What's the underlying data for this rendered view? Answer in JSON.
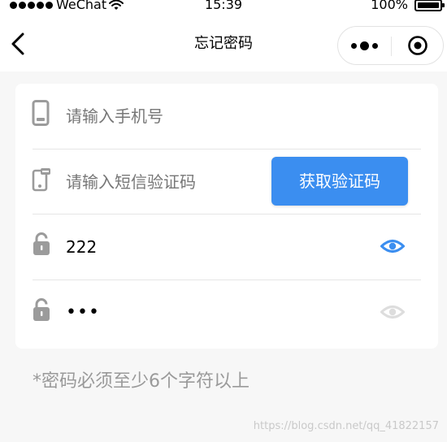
{
  "status_bar": {
    "carrier": "WeChat",
    "time": "15:39",
    "battery": "100%"
  },
  "nav": {
    "title": "忘记密码",
    "icons": [
      "back-chevron-icon",
      "more-dots-icon",
      "close-circle-icon"
    ]
  },
  "form": {
    "phone": {
      "placeholder": "请输入手机号",
      "value": "",
      "icon": "phone-icon"
    },
    "sms_code": {
      "placeholder": "请输入短信验证码",
      "value": "",
      "icon": "sms-phone-icon",
      "button_label": "获取验证码"
    },
    "password": {
      "value": "222",
      "visible": true,
      "icon": "lock-icon",
      "toggle_icon": "eye-icon"
    },
    "confirm_password": {
      "display": "•••",
      "visible": false,
      "icon": "lock-icon",
      "toggle_icon": "eye-icon"
    }
  },
  "hint": "*密码必须至少6个字符以上",
  "watermark": "https://blog.csdn.net/qq_41822157",
  "colors": {
    "primary": "#3b8ef0",
    "eye_active": "#3b8ef0",
    "eye_inactive": "#dddddd",
    "icon_gray": "#9b9b9b",
    "hint_text": "#9a9a9a",
    "background": "#f7f7f7"
  }
}
